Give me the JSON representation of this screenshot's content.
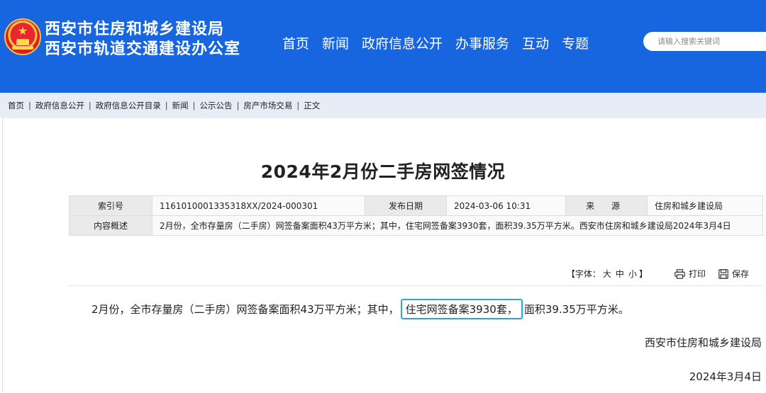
{
  "header": {
    "org_name_1": "西安市住房和城乡建设局",
    "org_name_2": "西安市轨道交通建设办公室",
    "nav": [
      "首页",
      "新闻",
      "政府信息公开",
      "办事服务",
      "互动",
      "专题"
    ],
    "search_placeholder": "请输入搜索关键词",
    "colors": {
      "header_bg": "#1766e0",
      "emblem_red": "#e8262c",
      "emblem_gold": "#f5c54a"
    },
    "emblem_icon": "national-emblem-icon"
  },
  "breadcrumb": {
    "items": [
      "首页",
      "政府信息公开",
      "政府信息公开目录",
      "新闻",
      "公示公告",
      "房产市场交易",
      "正文"
    ],
    "separator": "|"
  },
  "article": {
    "title": "2024年2月份二手房网签情况",
    "meta": {
      "index_label": "索引号",
      "index_value": "1161010001335318XX/2024-000301",
      "publish_label": "发布日期",
      "publish_value": "2024-03-06 10:31",
      "source_label": "来 源",
      "source_value": "住房和城乡建设局",
      "summary_label": "内容概述",
      "summary_value": "2月份，全市存量房（二手房）网签备案面积43万平方米；其中，住宅网签备案3930套，面积39.35万平方米。西安市住房和城乡建设局2024年3月4日"
    },
    "tools": {
      "font_label_open": "【字体：",
      "font_sizes": [
        "大",
        "中",
        "小"
      ],
      "font_label_close": "】",
      "print_label": "打印",
      "save_label": "保存",
      "print_icon": "printer-icon",
      "save_icon": "floppy-save-icon"
    },
    "body": {
      "part1": "2月份，全市存量房（二手房）网签备案面积43万平方米；其中，",
      "highlight": "住宅网签备案3930套，",
      "part2": "面积39.35万平方米。",
      "highlight_color": "#2aa7d8"
    },
    "signature": "西安市住房和城乡建设局",
    "date": "2024年3月4日"
  }
}
